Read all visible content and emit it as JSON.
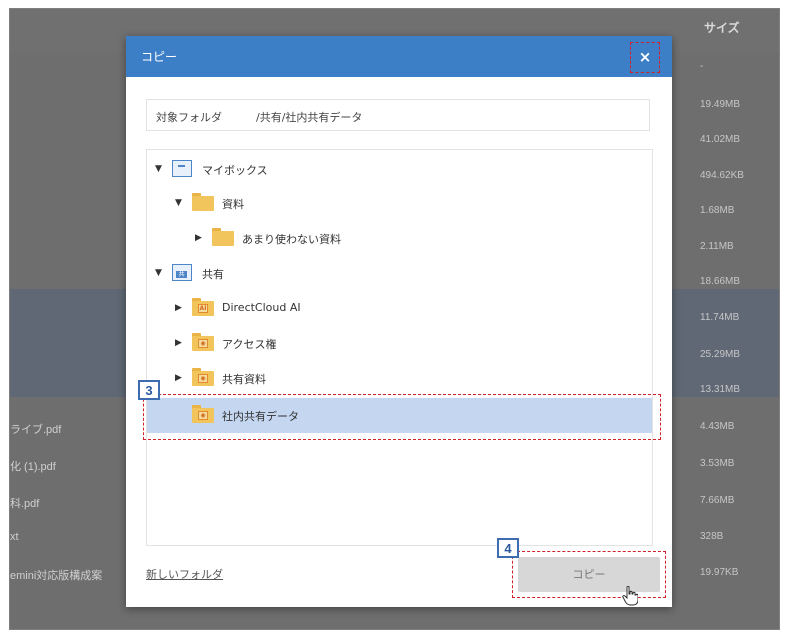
{
  "background": {
    "size_header": "サイズ",
    "sizes": [
      "-",
      "19.49MB",
      "41.02MB",
      "494.62KB",
      "1.68MB",
      "2.11MB",
      "18.66MB",
      "11.74MB",
      "25.29MB",
      "13.31MB",
      "4.43MB",
      "3.53MB",
      "7.66MB",
      "328B",
      "19.97KB"
    ],
    "file_names": [
      "ライブ.pdf",
      "化 (1).pdf",
      "科.pdf",
      "xt",
      "emini対応版構成案"
    ]
  },
  "dialog": {
    "title": "コピー",
    "close_symbol": "×",
    "target_label": "対象フォルダ",
    "target_path": "/共有/社内共有データ",
    "tree": [
      {
        "label": "マイボックス",
        "icon": "mybox-icon",
        "expander": "▼"
      },
      {
        "label": "資料",
        "icon": "folder-icon",
        "expander": "▼"
      },
      {
        "label": "あまり使わない資料",
        "icon": "folder-icon",
        "expander": "▶"
      },
      {
        "label": "共有",
        "icon": "shared-box-icon",
        "expander": "▼",
        "badge": "共"
      },
      {
        "label": "DirectCloud AI",
        "icon": "ai-folder-icon",
        "expander": "▶",
        "badge": "AI"
      },
      {
        "label": "アクセス権",
        "icon": "shared-folder-icon",
        "expander": "▶",
        "badge": "◉"
      },
      {
        "label": "共有資料",
        "icon": "shared-folder-icon",
        "expander": "▶",
        "badge": "◉"
      },
      {
        "label": "社内共有データ",
        "icon": "shared-folder-icon",
        "expander": "",
        "badge": "◉",
        "selected": true
      }
    ],
    "new_folder_link": "新しいフォルダ",
    "copy_button": "コピー"
  },
  "steps": {
    "step3": "3",
    "step4": "4"
  },
  "colors": {
    "titlebar": "#3d7fc7",
    "selected_row": "#c5d6f0",
    "highlight": "#d0202a",
    "step_border": "#3d6cb0"
  }
}
